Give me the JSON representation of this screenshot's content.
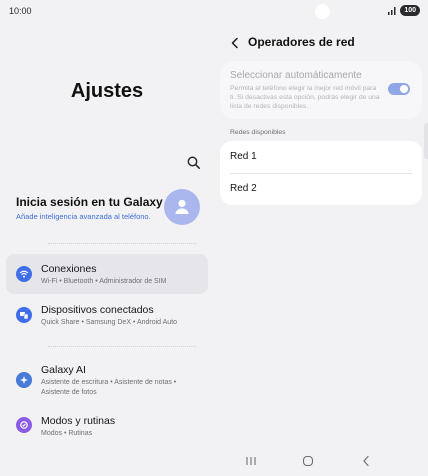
{
  "status_bar": {
    "time": "10:00",
    "battery": "100"
  },
  "left": {
    "title": "Ajustes",
    "account": {
      "title": "Inicia sesión en tu Galaxy",
      "subtitle": "Añade inteligencia avanzada al teléfono."
    },
    "menu": [
      {
        "title": "Conexiones",
        "subtitle": "Wi-Fi  •  Bluetooth  •  Administrador de SIM",
        "icon": "wifi-icon",
        "color": "#3f6ee8",
        "active": true
      },
      {
        "title": "Dispositivos conectados",
        "subtitle": "Quick Share  •  Samsung DeX  •  Android Auto",
        "icon": "devices-icon",
        "color": "#3f6ee8"
      },
      {
        "title": "Galaxy AI",
        "subtitle": "Asistente de escritura  •  Asistente de notas  •  Asistente de fotos",
        "icon": "galaxy-ai-icon",
        "color": "#4a7bd9"
      },
      {
        "title": "Modos y rutinas",
        "subtitle": "Modos  •  Rutinas",
        "icon": "modes-icon",
        "color": "#8a5ce6"
      }
    ]
  },
  "right": {
    "title": "Operadores de red",
    "auto_select": {
      "title": "Seleccionar automáticamente",
      "description": "Permita al teléfono elegir la mejor red móvil para ti. Si desactivas esta opción, podrás elegir de una lista de redes disponibles.",
      "enabled": true
    },
    "section_label": "Redes disponibles",
    "networks": [
      "Red 1",
      "Red 2"
    ]
  },
  "colors": {
    "accent": "#3f6ee8",
    "toggle": "#8fa7e6",
    "avatar": "#a9b7ee"
  }
}
